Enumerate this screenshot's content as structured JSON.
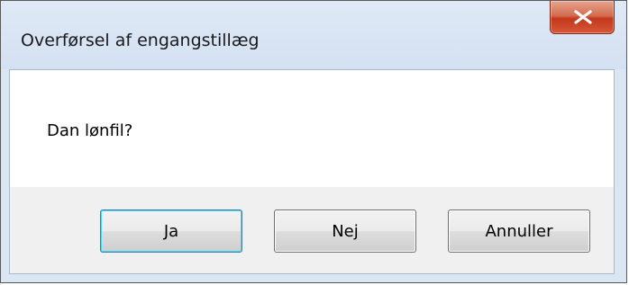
{
  "window": {
    "title": "Overførsel af engangstillæg"
  },
  "message": {
    "text": "Dan lønfil?"
  },
  "buttons": {
    "yes_label": "Ja",
    "no_label": "Nej",
    "cancel_label": "Annuller"
  },
  "icons": {
    "close": "close-icon"
  },
  "colors": {
    "titlebar": "#d4e1f2",
    "close_button": "#c2381b",
    "content_background": "#ffffff",
    "button_area": "#f0f0f0"
  }
}
